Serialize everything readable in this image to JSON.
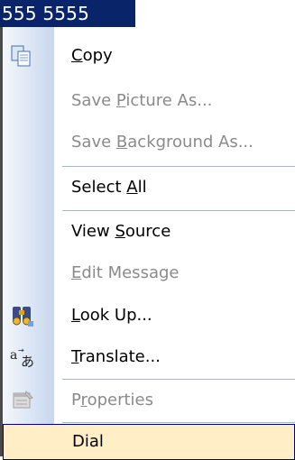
{
  "selection": {
    "text": "555 5555"
  },
  "menu": {
    "copy": {
      "pre": "",
      "key": "C",
      "post": "opy"
    },
    "save_picture": {
      "pre": "Save ",
      "key": "P",
      "post": "icture As..."
    },
    "save_background": {
      "pre": "Save ",
      "key": "B",
      "post": "ackground As..."
    },
    "select_all": {
      "pre": "Select ",
      "key": "A",
      "post": "ll"
    },
    "view_source": {
      "pre": "View ",
      "key": "S",
      "post": "ource"
    },
    "edit_message": {
      "pre": "",
      "key": "E",
      "post": "dit Message"
    },
    "look_up": {
      "pre": "",
      "key": "L",
      "post": "ook Up..."
    },
    "translate": {
      "pre": "",
      "key": "T",
      "post": "ranslate..."
    },
    "properties": {
      "pre": "P",
      "key": "r",
      "post": "operties"
    },
    "dial": {
      "label": "Dial"
    }
  },
  "colors": {
    "selection_bg": "#0a246a",
    "hover_bg": "#ffeec6",
    "disabled_text": "#8a8a8a"
  }
}
